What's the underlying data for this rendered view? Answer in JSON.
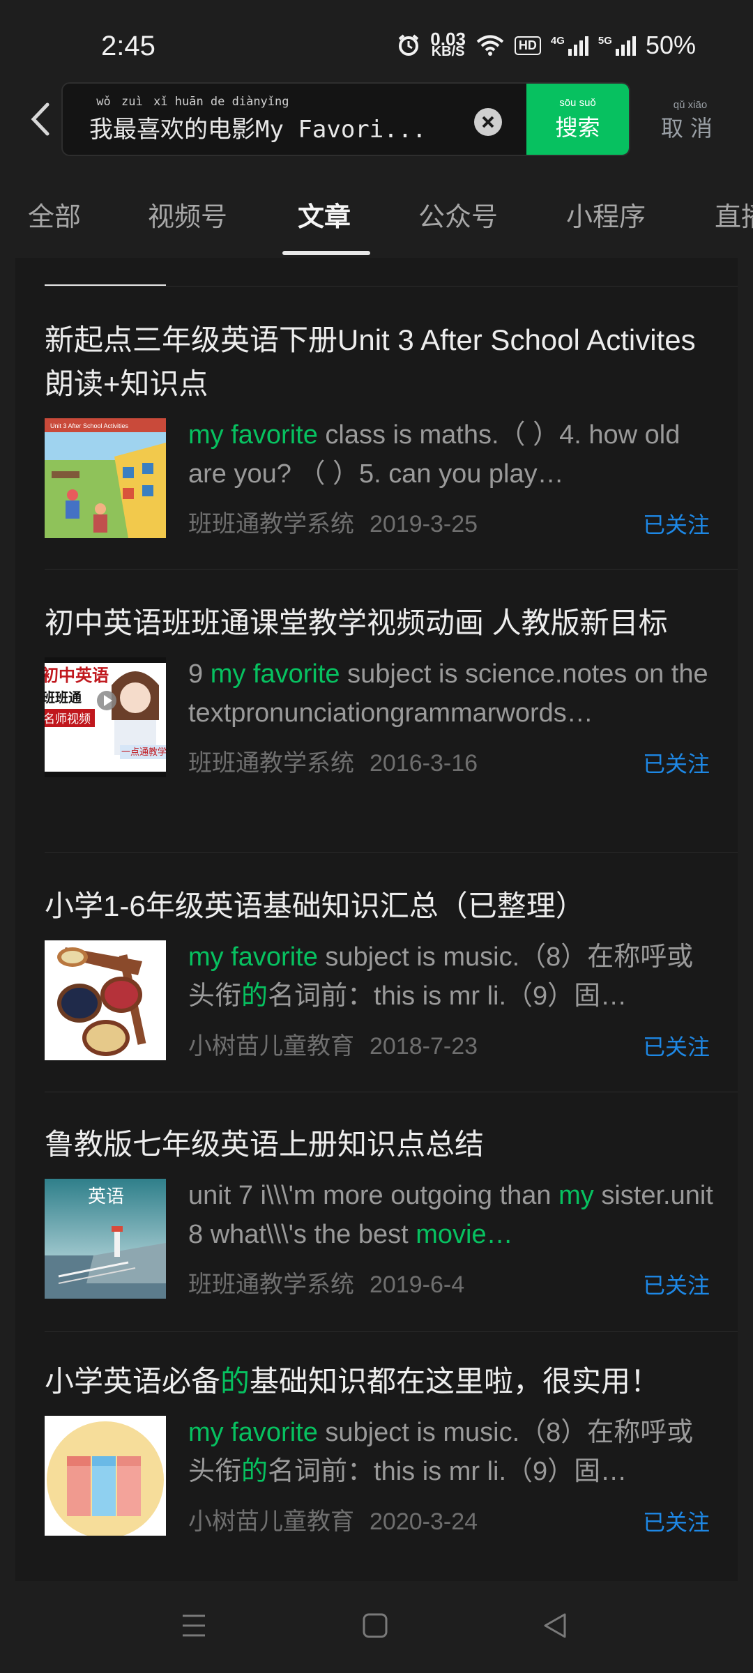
{
  "status": {
    "time": "2:45",
    "net_speed_value": "0.03",
    "net_speed_unit": "KB/S",
    "hd_label": "HD",
    "net1": "4G",
    "net2": "5G",
    "battery": "50%"
  },
  "search": {
    "query_pinyin": [
      "wǒ",
      "zuì",
      "xǐ",
      "huān",
      "de",
      "diàn",
      "yǐng"
    ],
    "query": "我最喜欢的电影My Favori...",
    "button_pinyin": "sōu suǒ",
    "button_label": "搜索",
    "cancel_pinyin": "qǔ xiāo",
    "cancel_label": "取消"
  },
  "tabs": [
    "全部",
    "视频号",
    "文章",
    "公众号",
    "小程序",
    "直播"
  ],
  "active_tab": "文章",
  "results": [
    {
      "title": "新起点三年级英语下册Unit 3 After School Activites 朗读+知识点",
      "snippet_parts": [
        {
          "t": "my favorite",
          "hl": true
        },
        {
          "t": " class is maths.（ ）4. how old are you? （ ）5. can you play…",
          "hl": false
        }
      ],
      "source": "班班通教学系统",
      "date": "2019-3-25",
      "follow": "已关注",
      "thumb_label": "Unit 3 After School Activities"
    },
    {
      "title": "初中英语班班通课堂教学视频动画 人教版新目标",
      "snippet_parts": [
        {
          "t": "9 ",
          "hl": false
        },
        {
          "t": "my favorite",
          "hl": true
        },
        {
          "t": " subject is science.notes on the textpronunciationgrammarwords…",
          "hl": false
        }
      ],
      "source": "班班通教学系统",
      "date": "2016-3-16",
      "follow": "已关注",
      "thumb_lines": [
        "初中英语",
        "班班通",
        "名师视频",
        "一点通教学"
      ]
    },
    {
      "title": "小学1-6年级英语基础知识汇总（已整理）",
      "snippet_parts": [
        {
          "t": "my favorite",
          "hl": true
        },
        {
          "t": " subject is music.（8）在称呼或头衔",
          "hl": false
        },
        {
          "t": "的",
          "hl": true
        },
        {
          "t": "名词前：this is mr li.（9）固…",
          "hl": false
        }
      ],
      "source": "小树苗儿童教育",
      "date": "2018-7-23",
      "follow": "已关注"
    },
    {
      "title": "鲁教版七年级英语上册知识点总结",
      "snippet_parts": [
        {
          "t": "unit 7 i\\\\\\'m more outgoing than ",
          "hl": false
        },
        {
          "t": "my",
          "hl": true
        },
        {
          "t": " sister.unit 8 what\\\\\\'s the best ",
          "hl": false
        },
        {
          "t": "movie…",
          "hl": true
        }
      ],
      "source": "班班通教学系统",
      "date": "2019-6-4",
      "follow": "已关注",
      "thumb_label": "英语"
    },
    {
      "title_parts": [
        {
          "t": "小学英语必备",
          "hl": false
        },
        {
          "t": "的",
          "hl": true
        },
        {
          "t": "基础知识都在这里啦，很实用！",
          "hl": false
        }
      ],
      "snippet_parts": [
        {
          "t": "my favorite",
          "hl": true
        },
        {
          "t": " subject is music.（8）在称呼或头衔",
          "hl": false
        },
        {
          "t": "的",
          "hl": true
        },
        {
          "t": "名词前：this is mr li.（9）固…",
          "hl": false
        }
      ],
      "source": "小树苗儿童教育",
      "date": "2020-3-24",
      "follow": "已关注"
    }
  ],
  "colors": {
    "accent": "#07c160",
    "follow": "#1e88e5",
    "background": "#1e1e1e"
  }
}
